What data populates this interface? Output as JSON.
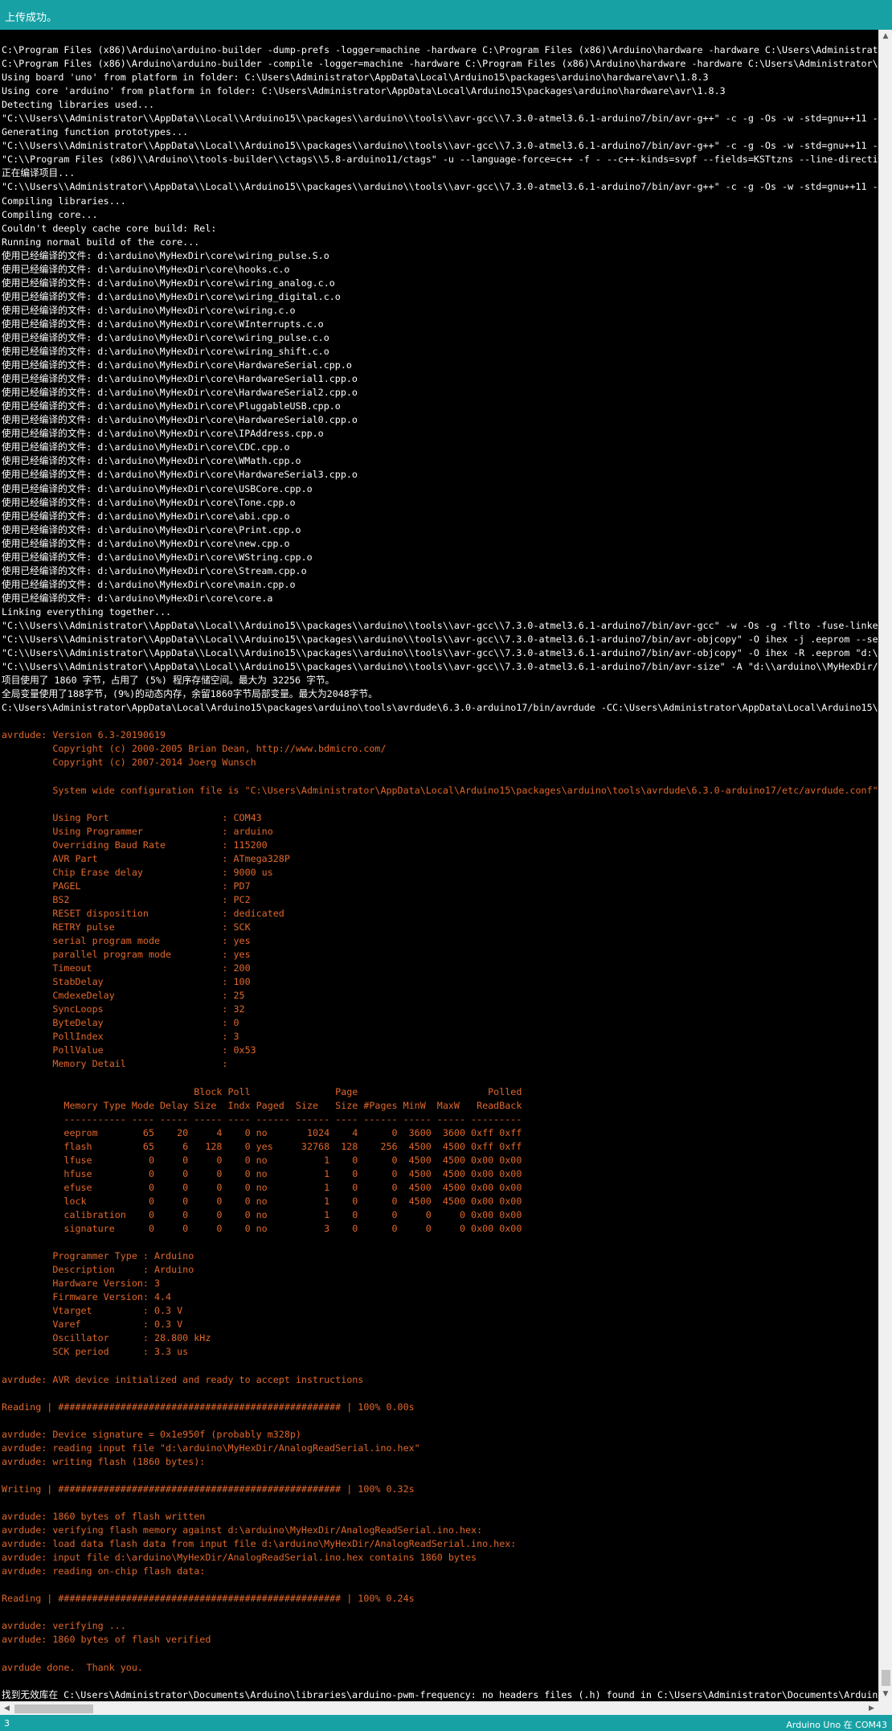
{
  "status_top": {
    "message": "上传成功。"
  },
  "status_bottom": {
    "line_number": "3",
    "board_port": "Arduino Uno 在 COM43"
  },
  "colors": {
    "teal": "#17a1a5",
    "console_bg": "#000000",
    "white_text": "#ffffff",
    "orange_text": "#e0672b"
  },
  "console": {
    "lines": [
      {
        "text": "C:\\Program Files (x86)\\Arduino\\arduino-builder -dump-prefs -logger=machine -hardware C:\\Program Files (x86)\\Arduino\\hardware -hardware C:\\Users\\Administrato",
        "color": "white"
      },
      {
        "text": "C:\\Program Files (x86)\\Arduino\\arduino-builder -compile -logger=machine -hardware C:\\Program Files (x86)\\Arduino\\hardware -hardware C:\\Users\\Administrator\\A",
        "color": "white"
      },
      {
        "text": "Using board 'uno' from platform in folder: C:\\Users\\Administrator\\AppData\\Local\\Arduino15\\packages\\arduino\\hardware\\avr\\1.8.3",
        "color": "white"
      },
      {
        "text": "Using core 'arduino' from platform in folder: C:\\Users\\Administrator\\AppData\\Local\\Arduino15\\packages\\arduino\\hardware\\avr\\1.8.3",
        "color": "white"
      },
      {
        "text": "Detecting libraries used...",
        "color": "white"
      },
      {
        "text": "\"C:\\\\Users\\\\Administrator\\\\AppData\\\\Local\\\\Arduino15\\\\packages\\\\arduino\\\\tools\\\\avr-gcc\\\\7.3.0-atmel3.6.1-arduino7/bin/avr-g++\" -c -g -Os -w -std=gnu++11 -f",
        "color": "white"
      },
      {
        "text": "Generating function prototypes...",
        "color": "white"
      },
      {
        "text": "\"C:\\\\Users\\\\Administrator\\\\AppData\\\\Local\\\\Arduino15\\\\packages\\\\arduino\\\\tools\\\\avr-gcc\\\\7.3.0-atmel3.6.1-arduino7/bin/avr-g++\" -c -g -Os -w -std=gnu++11 -f",
        "color": "white"
      },
      {
        "text": "\"C:\\\\Program Files (x86)\\\\Arduino\\\\tools-builder\\\\ctags\\\\5.8-arduino11/ctags\" -u --language-force=c++ -f - --c++-kinds=svpf --fields=KSTtzns --line-directiv",
        "color": "white"
      },
      {
        "text": "正在编译项目...",
        "color": "white"
      },
      {
        "text": "\"C:\\\\Users\\\\Administrator\\\\AppData\\\\Local\\\\Arduino15\\\\packages\\\\arduino\\\\tools\\\\avr-gcc\\\\7.3.0-atmel3.6.1-arduino7/bin/avr-g++\" -c -g -Os -w -std=gnu++11 -f",
        "color": "white"
      },
      {
        "text": "Compiling libraries...",
        "color": "white"
      },
      {
        "text": "Compiling core...",
        "color": "white"
      },
      {
        "text": "Couldn't deeply cache core build: Rel:",
        "color": "white"
      },
      {
        "text": "Running normal build of the core...",
        "color": "white"
      },
      {
        "text": "使用已经编译的文件: d:\\arduino\\MyHexDir\\core\\wiring_pulse.S.o",
        "color": "white"
      },
      {
        "text": "使用已经编译的文件: d:\\arduino\\MyHexDir\\core\\hooks.c.o",
        "color": "white"
      },
      {
        "text": "使用已经编译的文件: d:\\arduino\\MyHexDir\\core\\wiring_analog.c.o",
        "color": "white"
      },
      {
        "text": "使用已经编译的文件: d:\\arduino\\MyHexDir\\core\\wiring_digital.c.o",
        "color": "white"
      },
      {
        "text": "使用已经编译的文件: d:\\arduino\\MyHexDir\\core\\wiring.c.o",
        "color": "white"
      },
      {
        "text": "使用已经编译的文件: d:\\arduino\\MyHexDir\\core\\WInterrupts.c.o",
        "color": "white"
      },
      {
        "text": "使用已经编译的文件: d:\\arduino\\MyHexDir\\core\\wiring_pulse.c.o",
        "color": "white"
      },
      {
        "text": "使用已经编译的文件: d:\\arduino\\MyHexDir\\core\\wiring_shift.c.o",
        "color": "white"
      },
      {
        "text": "使用已经编译的文件: d:\\arduino\\MyHexDir\\core\\HardwareSerial.cpp.o",
        "color": "white"
      },
      {
        "text": "使用已经编译的文件: d:\\arduino\\MyHexDir\\core\\HardwareSerial1.cpp.o",
        "color": "white"
      },
      {
        "text": "使用已经编译的文件: d:\\arduino\\MyHexDir\\core\\HardwareSerial2.cpp.o",
        "color": "white"
      },
      {
        "text": "使用已经编译的文件: d:\\arduino\\MyHexDir\\core\\PluggableUSB.cpp.o",
        "color": "white"
      },
      {
        "text": "使用已经编译的文件: d:\\arduino\\MyHexDir\\core\\HardwareSerial0.cpp.o",
        "color": "white"
      },
      {
        "text": "使用已经编译的文件: d:\\arduino\\MyHexDir\\core\\IPAddress.cpp.o",
        "color": "white"
      },
      {
        "text": "使用已经编译的文件: d:\\arduino\\MyHexDir\\core\\CDC.cpp.o",
        "color": "white"
      },
      {
        "text": "使用已经编译的文件: d:\\arduino\\MyHexDir\\core\\WMath.cpp.o",
        "color": "white"
      },
      {
        "text": "使用已经编译的文件: d:\\arduino\\MyHexDir\\core\\HardwareSerial3.cpp.o",
        "color": "white"
      },
      {
        "text": "使用已经编译的文件: d:\\arduino\\MyHexDir\\core\\USBCore.cpp.o",
        "color": "white"
      },
      {
        "text": "使用已经编译的文件: d:\\arduino\\MyHexDir\\core\\Tone.cpp.o",
        "color": "white"
      },
      {
        "text": "使用已经编译的文件: d:\\arduino\\MyHexDir\\core\\abi.cpp.o",
        "color": "white"
      },
      {
        "text": "使用已经编译的文件: d:\\arduino\\MyHexDir\\core\\Print.cpp.o",
        "color": "white"
      },
      {
        "text": "使用已经编译的文件: d:\\arduino\\MyHexDir\\core\\new.cpp.o",
        "color": "white"
      },
      {
        "text": "使用已经编译的文件: d:\\arduino\\MyHexDir\\core\\WString.cpp.o",
        "color": "white"
      },
      {
        "text": "使用已经编译的文件: d:\\arduino\\MyHexDir\\core\\Stream.cpp.o",
        "color": "white"
      },
      {
        "text": "使用已经编译的文件: d:\\arduino\\MyHexDir\\core\\main.cpp.o",
        "color": "white"
      },
      {
        "text": "使用已经编译的文件: d:\\arduino\\MyHexDir\\core\\core.a",
        "color": "white"
      },
      {
        "text": "Linking everything together...",
        "color": "white"
      },
      {
        "text": "\"C:\\\\Users\\\\Administrator\\\\AppData\\\\Local\\\\Arduino15\\\\packages\\\\arduino\\\\tools\\\\avr-gcc\\\\7.3.0-atmel3.6.1-arduino7/bin/avr-gcc\" -w -Os -g -flto -fuse-linker",
        "color": "white"
      },
      {
        "text": "\"C:\\\\Users\\\\Administrator\\\\AppData\\\\Local\\\\Arduino15\\\\packages\\\\arduino\\\\tools\\\\avr-gcc\\\\7.3.0-atmel3.6.1-arduino7/bin/avr-objcopy\" -O ihex -j .eeprom --set",
        "color": "white"
      },
      {
        "text": "\"C:\\\\Users\\\\Administrator\\\\AppData\\\\Local\\\\Arduino15\\\\packages\\\\arduino\\\\tools\\\\avr-gcc\\\\7.3.0-atmel3.6.1-arduino7/bin/avr-objcopy\" -O ihex -R .eeprom \"d:\\\\",
        "color": "white"
      },
      {
        "text": "\"C:\\\\Users\\\\Administrator\\\\AppData\\\\Local\\\\Arduino15\\\\packages\\\\arduino\\\\tools\\\\avr-gcc\\\\7.3.0-atmel3.6.1-arduino7/bin/avr-size\" -A \"d:\\\\arduino\\\\MyHexDir/A",
        "color": "white"
      },
      {
        "text": "项目使用了 1860 字节，占用了 (5%) 程序存储空间。最大为 32256 字节。",
        "color": "white"
      },
      {
        "text": "全局变量使用了188字节，(9%)的动态内存，余留1860字节局部变量。最大为2048字节。",
        "color": "white"
      },
      {
        "text": "C:\\Users\\Administrator\\AppData\\Local\\Arduino15\\packages\\arduino\\tools\\avrdude\\6.3.0-arduino17/bin/avrdude -CC:\\Users\\Administrator\\AppData\\Local\\Arduino15\\p",
        "color": "white"
      },
      {
        "text": "",
        "color": "white"
      },
      {
        "text": "avrdude: Version 6.3-20190619",
        "color": "orange"
      },
      {
        "text": "         Copyright (c) 2000-2005 Brian Dean, http://www.bdmicro.com/",
        "color": "orange"
      },
      {
        "text": "         Copyright (c) 2007-2014 Joerg Wunsch",
        "color": "orange"
      },
      {
        "text": "",
        "color": "orange"
      },
      {
        "text": "         System wide configuration file is \"C:\\Users\\Administrator\\AppData\\Local\\Arduino15\\packages\\arduino\\tools\\avrdude\\6.3.0-arduino17/etc/avrdude.conf\"",
        "color": "orange"
      },
      {
        "text": "",
        "color": "orange"
      },
      {
        "text": "         Using Port                    : COM43",
        "color": "orange"
      },
      {
        "text": "         Using Programmer              : arduino",
        "color": "orange"
      },
      {
        "text": "         Overriding Baud Rate          : 115200",
        "color": "orange"
      },
      {
        "text": "         AVR Part                      : ATmega328P",
        "color": "orange"
      },
      {
        "text": "         Chip Erase delay              : 9000 us",
        "color": "orange"
      },
      {
        "text": "         PAGEL                         : PD7",
        "color": "orange"
      },
      {
        "text": "         BS2                           : PC2",
        "color": "orange"
      },
      {
        "text": "         RESET disposition             : dedicated",
        "color": "orange"
      },
      {
        "text": "         RETRY pulse                   : SCK",
        "color": "orange"
      },
      {
        "text": "         serial program mode           : yes",
        "color": "orange"
      },
      {
        "text": "         parallel program mode         : yes",
        "color": "orange"
      },
      {
        "text": "         Timeout                       : 200",
        "color": "orange"
      },
      {
        "text": "         StabDelay                     : 100",
        "color": "orange"
      },
      {
        "text": "         CmdexeDelay                   : 25",
        "color": "orange"
      },
      {
        "text": "         SyncLoops                     : 32",
        "color": "orange"
      },
      {
        "text": "         ByteDelay                     : 0",
        "color": "orange"
      },
      {
        "text": "         PollIndex                     : 3",
        "color": "orange"
      },
      {
        "text": "         PollValue                     : 0x53",
        "color": "orange"
      },
      {
        "text": "         Memory Detail                 :",
        "color": "orange"
      },
      {
        "text": "",
        "color": "orange"
      },
      {
        "text": "                                  Block Poll               Page                       Polled",
        "color": "orange"
      },
      {
        "text": "           Memory Type Mode Delay Size  Indx Paged  Size   Size #Pages MinW  MaxW   ReadBack",
        "color": "orange"
      },
      {
        "text": "           ----------- ---- ----- ----- ---- ------ ------ ---- ------ ----- ----- ---------",
        "color": "orange"
      },
      {
        "text": "           eeprom        65    20     4    0 no       1024    4      0  3600  3600 0xff 0xff",
        "color": "orange"
      },
      {
        "text": "           flash         65     6   128    0 yes     32768  128    256  4500  4500 0xff 0xff",
        "color": "orange"
      },
      {
        "text": "           lfuse          0     0     0    0 no          1    0      0  4500  4500 0x00 0x00",
        "color": "orange"
      },
      {
        "text": "           hfuse          0     0     0    0 no          1    0      0  4500  4500 0x00 0x00",
        "color": "orange"
      },
      {
        "text": "           efuse          0     0     0    0 no          1    0      0  4500  4500 0x00 0x00",
        "color": "orange"
      },
      {
        "text": "           lock           0     0     0    0 no          1    0      0  4500  4500 0x00 0x00",
        "color": "orange"
      },
      {
        "text": "           calibration    0     0     0    0 no          1    0      0     0     0 0x00 0x00",
        "color": "orange"
      },
      {
        "text": "           signature      0     0     0    0 no          3    0      0     0     0 0x00 0x00",
        "color": "orange"
      },
      {
        "text": "",
        "color": "orange"
      },
      {
        "text": "         Programmer Type : Arduino",
        "color": "orange"
      },
      {
        "text": "         Description     : Arduino",
        "color": "orange"
      },
      {
        "text": "         Hardware Version: 3",
        "color": "orange"
      },
      {
        "text": "         Firmware Version: 4.4",
        "color": "orange"
      },
      {
        "text": "         Vtarget         : 0.3 V",
        "color": "orange"
      },
      {
        "text": "         Varef           : 0.3 V",
        "color": "orange"
      },
      {
        "text": "         Oscillator      : 28.800 kHz",
        "color": "orange"
      },
      {
        "text": "         SCK period      : 3.3 us",
        "color": "orange"
      },
      {
        "text": "",
        "color": "orange"
      },
      {
        "text": "avrdude: AVR device initialized and ready to accept instructions",
        "color": "orange"
      },
      {
        "text": "",
        "color": "orange"
      },
      {
        "text": "Reading | ################################################## | 100% 0.00s",
        "color": "orange"
      },
      {
        "text": "",
        "color": "orange"
      },
      {
        "text": "avrdude: Device signature = 0x1e950f (probably m328p)",
        "color": "orange"
      },
      {
        "text": "avrdude: reading input file \"d:\\arduino\\MyHexDir/AnalogReadSerial.ino.hex\"",
        "color": "orange"
      },
      {
        "text": "avrdude: writing flash (1860 bytes):",
        "color": "orange"
      },
      {
        "text": "",
        "color": "orange"
      },
      {
        "text": "Writing | ################################################## | 100% 0.32s",
        "color": "orange"
      },
      {
        "text": "",
        "color": "orange"
      },
      {
        "text": "avrdude: 1860 bytes of flash written",
        "color": "orange"
      },
      {
        "text": "avrdude: verifying flash memory against d:\\arduino\\MyHexDir/AnalogReadSerial.ino.hex:",
        "color": "orange"
      },
      {
        "text": "avrdude: load data flash data from input file d:\\arduino\\MyHexDir/AnalogReadSerial.ino.hex:",
        "color": "orange"
      },
      {
        "text": "avrdude: input file d:\\arduino\\MyHexDir/AnalogReadSerial.ino.hex contains 1860 bytes",
        "color": "orange"
      },
      {
        "text": "avrdude: reading on-chip flash data:",
        "color": "orange"
      },
      {
        "text": "",
        "color": "orange"
      },
      {
        "text": "Reading | ################################################## | 100% 0.24s",
        "color": "orange"
      },
      {
        "text": "",
        "color": "orange"
      },
      {
        "text": "avrdude: verifying ...",
        "color": "orange"
      },
      {
        "text": "avrdude: 1860 bytes of flash verified",
        "color": "orange"
      },
      {
        "text": "",
        "color": "orange"
      },
      {
        "text": "avrdude done.  Thank you.",
        "color": "orange"
      },
      {
        "text": "",
        "color": "orange"
      },
      {
        "text": "找到无效库在 C:\\Users\\Administrator\\Documents\\Arduino\\libraries\\arduino-pwm-frequency: no headers files (.h) found in C:\\Users\\Administrator\\Documents\\Arduino",
        "color": "white"
      }
    ]
  },
  "scrollbars": {
    "up_arrow": "▲",
    "down_arrow": "▼",
    "left_arrow": "◀",
    "right_arrow": "▶"
  }
}
